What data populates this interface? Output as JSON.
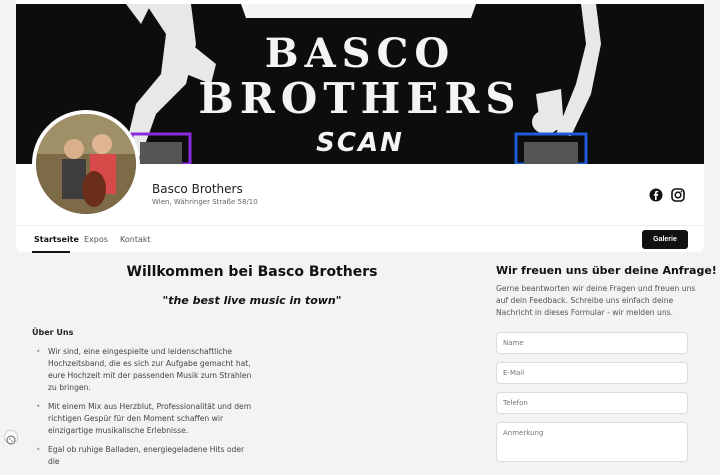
{
  "cover": {
    "line1": "BASCO",
    "line2": "BROTHERS",
    "line3": "SCAN"
  },
  "profile": {
    "name": "Basco Brothers",
    "address": "Wien, Währinger Straße 58/10"
  },
  "nav": {
    "tabs": [
      "Startseite",
      "Expos",
      "Kontakt"
    ],
    "gallery_button": "Galerie"
  },
  "main": {
    "title": "Willkommen bei Basco Brothers",
    "tagline": "\"the best live music in town\"",
    "about_heading": "Über Uns",
    "bullets": [
      "Wir sind, eine eingespielte und leidenschaftliche Hochzeitsband, die es sich zur Aufgabe gemacht hat, eure Hochzeit mit der passenden Musik zum Strahlen zu bringen.",
      "Mit einem Mix aus Herzblut, Professionalität und dem richtigen Gespür für den Moment schaffen wir einzigartige musikalische Erlebnisse.",
      "Egal ob ruhige Balladen, energiegeladene Hits oder die"
    ]
  },
  "form": {
    "heading": "Wir freuen uns über deine Anfrage!",
    "description": "Gerne beantworten wir deine Fragen und freuen uns auf dein Feedback. Schreibe uns einfach deine Nachricht in dieses Formular - wir melden uns.",
    "placeholders": {
      "name": "Name",
      "email": "E-Mail",
      "phone": "Telefon",
      "note": "Anmerkung"
    }
  },
  "colors": {
    "accent": "#111111",
    "cover_bg": "#0d0d0d",
    "qr_left": "#8a2be2",
    "qr_right": "#1e5bd8"
  },
  "icons": [
    "facebook-icon",
    "instagram-icon",
    "cookie-settings-icon"
  ]
}
